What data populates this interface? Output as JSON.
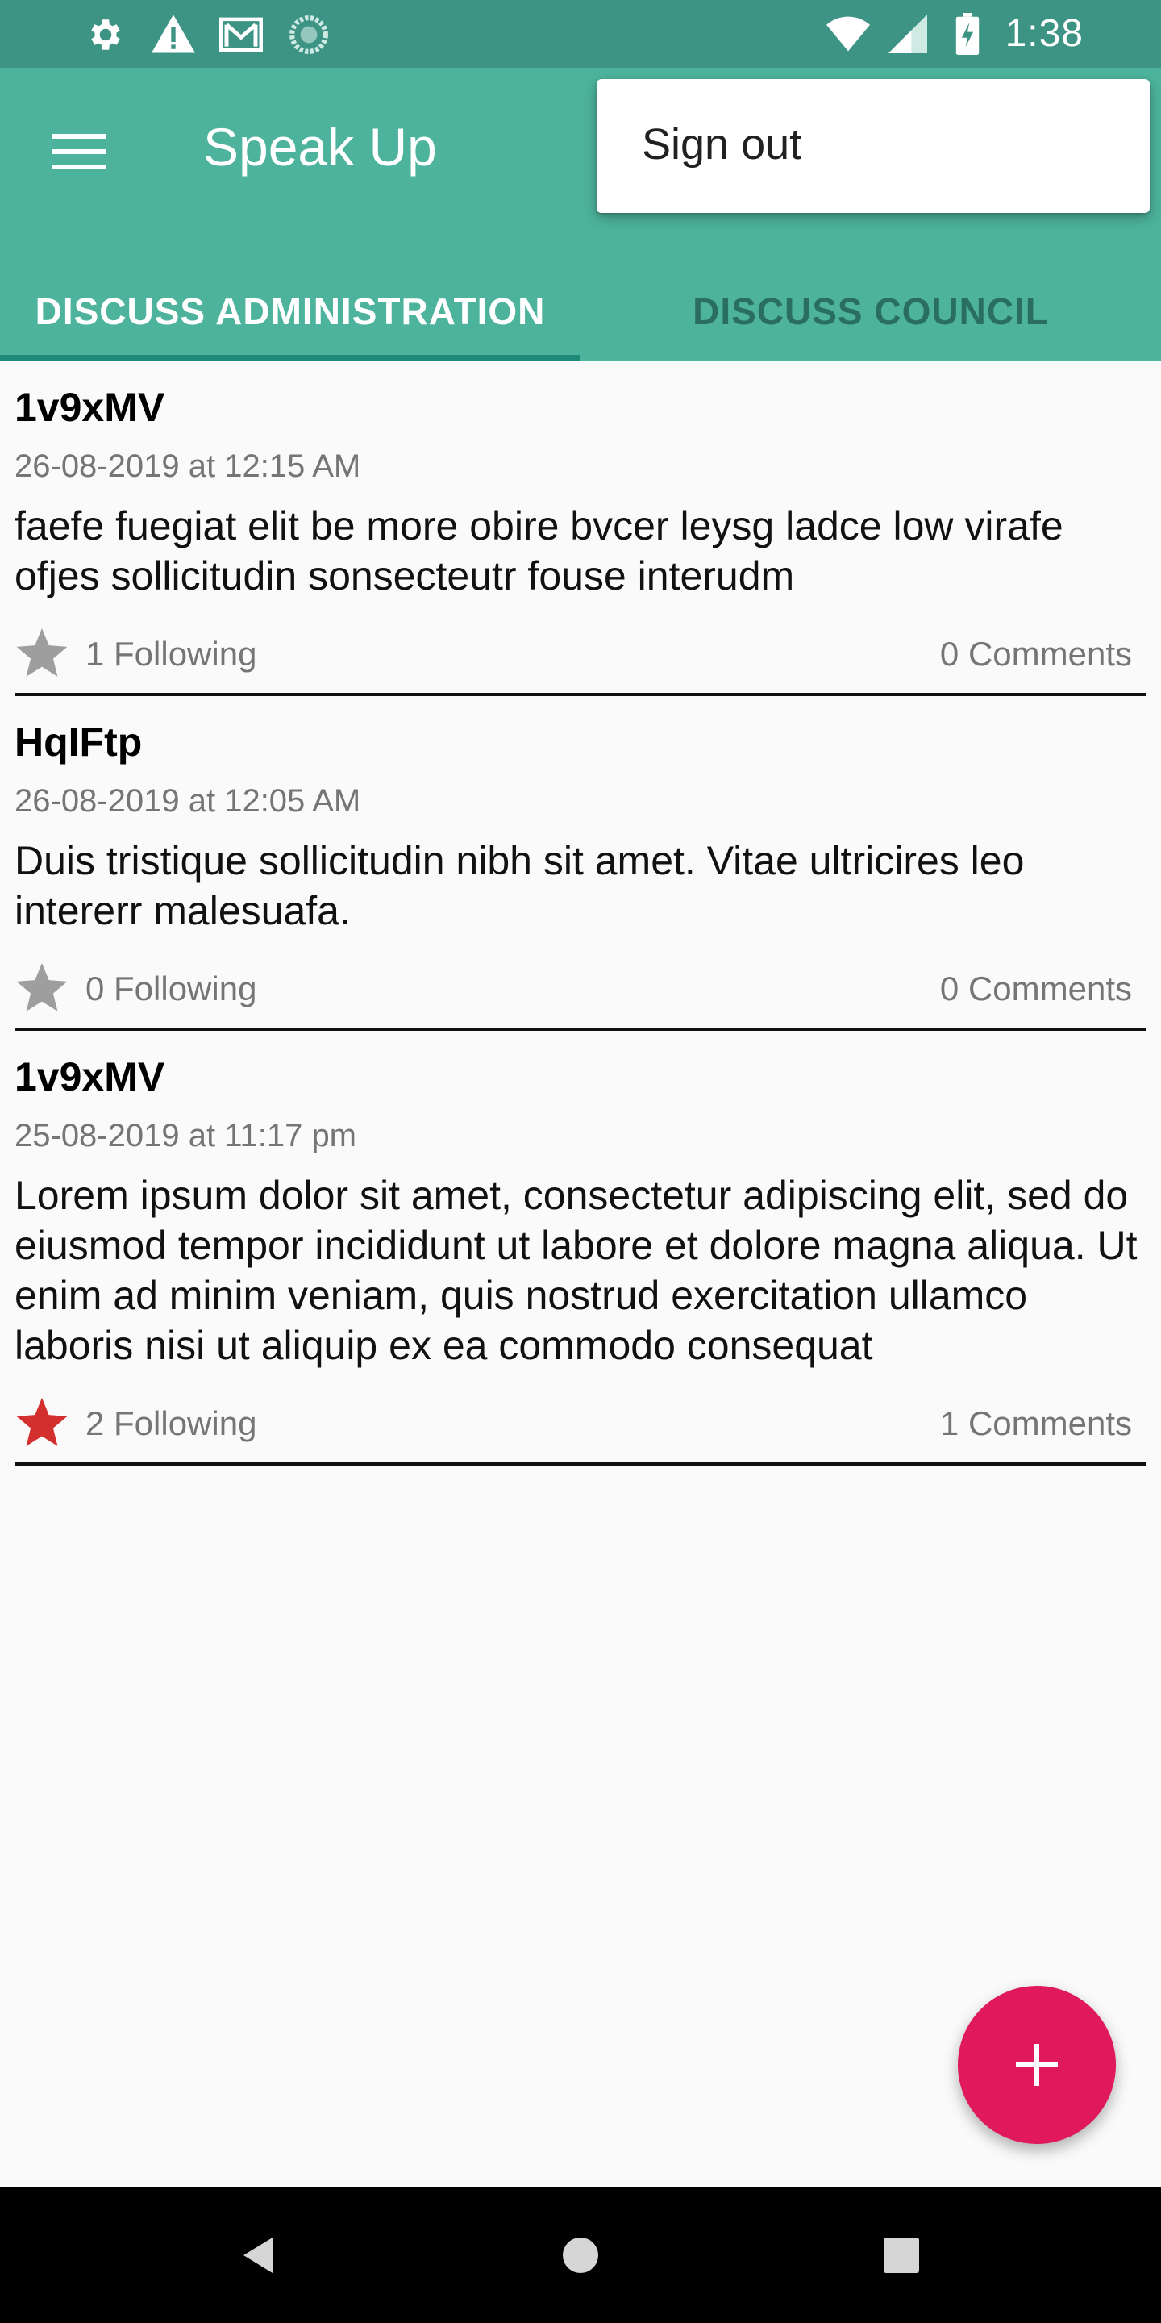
{
  "status_bar": {
    "time": "1:38",
    "icons_left": [
      "gear-icon",
      "warning-icon",
      "mail-icon",
      "sync-icon"
    ],
    "icons_right": [
      "wifi-icon",
      "signal-icon",
      "battery-icon"
    ]
  },
  "app_bar": {
    "title": "Speak Up",
    "tabs": [
      {
        "label": "DISCUSS ADMINISTRATION",
        "active": true
      },
      {
        "label": "DISCUSS COUNCIL",
        "active": false
      }
    ]
  },
  "overflow_menu": {
    "items": [
      {
        "label": "Sign out"
      }
    ]
  },
  "posts": [
    {
      "author": "1v9xMV",
      "date": "26-08-2019 at 12:15 AM",
      "body": "faefe fuegiat elit be more obire bvcer leysg ladce low virafe ofjes sollicitudin sonsecteutr fouse interudm",
      "following": "1 Following",
      "comments": "0 Comments",
      "starred": false
    },
    {
      "author": "HqIFtp",
      "date": "26-08-2019 at 12:05 AM",
      "body": "Duis tristique sollicitudin nibh sit amet. Vitae ultricires leo intererr malesuafa.",
      "following": "0 Following",
      "comments": "0 Comments",
      "starred": false
    },
    {
      "author": "1v9xMV",
      "date": "25-08-2019 at 11:17 pm",
      "body": "Lorem ipsum dolor sit amet, consectetur adipiscing elit, sed do eiusmod tempor incididunt ut labore et dolore magna aliqua. Ut enim ad minim veniam, quis nostrud exercitation ullamco laboris nisi ut aliquip ex ea commodo consequat",
      "following": "2 Following",
      "comments": "1 Comments",
      "starred": true
    }
  ],
  "fab": {
    "icon": "plus-icon"
  },
  "nav_bar": {
    "buttons": [
      "back-icon",
      "home-icon",
      "recents-icon"
    ]
  },
  "colors": {
    "status_bar": "#3d9485",
    "app_bar": "#4db39c",
    "tab_indicator": "#1d8a78",
    "fab": "#e0185c",
    "star_active": "#d32f2f",
    "star_inactive": "#9e9e9e"
  }
}
